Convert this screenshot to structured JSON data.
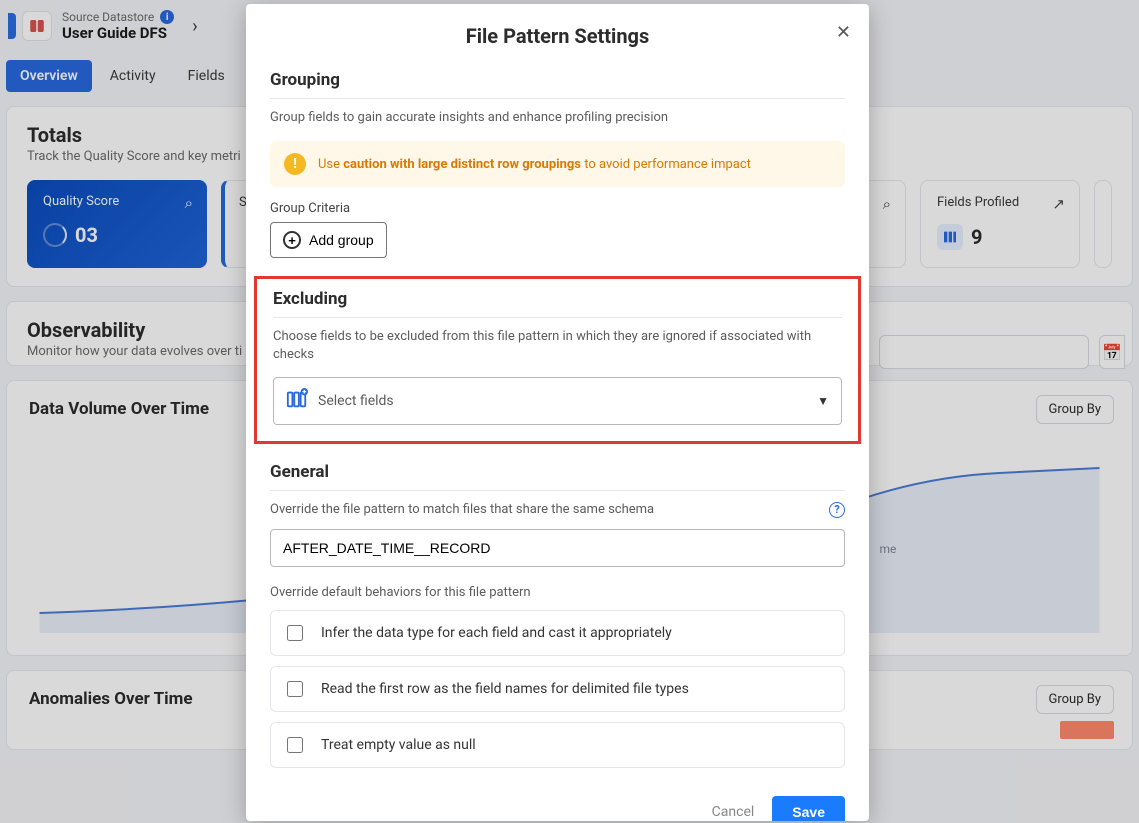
{
  "breadcrumb": {
    "subtitle": "Source Datastore",
    "title": "User Guide DFS"
  },
  "tabs": [
    {
      "label": "Overview",
      "active": true
    },
    {
      "label": "Activity"
    },
    {
      "label": "Fields"
    }
  ],
  "totals": {
    "heading": "Totals",
    "sub": "Track the Quality Score and key metri",
    "cards": {
      "quality": {
        "label": "Quality Score",
        "value": "03"
      },
      "sampling": {
        "label": "Sam"
      },
      "fields": {
        "label": "Fields Profiled",
        "value": "9"
      }
    }
  },
  "observability": {
    "heading": "Observability",
    "sub": "Monitor how your data evolves over ti"
  },
  "chart1": {
    "title": "Data Volume Over Time",
    "groupby": "Group By",
    "ytick": "me"
  },
  "chart2": {
    "title": "Anomalies Over Time",
    "groupby": "Group By"
  },
  "modal": {
    "title": "File Pattern Settings",
    "grouping": {
      "heading": "Grouping",
      "desc": "Group fields to gain accurate insights and enhance profiling precision",
      "warning_prefix": "Use ",
      "warning_bold": "caution with large distinct row groupings",
      "warning_suffix": " to avoid performance impact",
      "criteria_label": "Group Criteria",
      "add_group": "Add group"
    },
    "excluding": {
      "heading": "Excluding",
      "desc": "Choose fields to be excluded from this file pattern in which they are ignored if associated with checks",
      "select_placeholder": "Select fields"
    },
    "general": {
      "heading": "General",
      "desc": "Override the file pattern to match files that share the same schema",
      "input_value": "AFTER_DATE_TIME__RECORD",
      "override_label": "Override default behaviors for this file pattern",
      "options": [
        "Infer the data type for each field and cast it appropriately",
        "Read the first row as the field names for delimited file types",
        "Treat empty value as null"
      ]
    },
    "actions": {
      "cancel": "Cancel",
      "save": "Save"
    }
  }
}
